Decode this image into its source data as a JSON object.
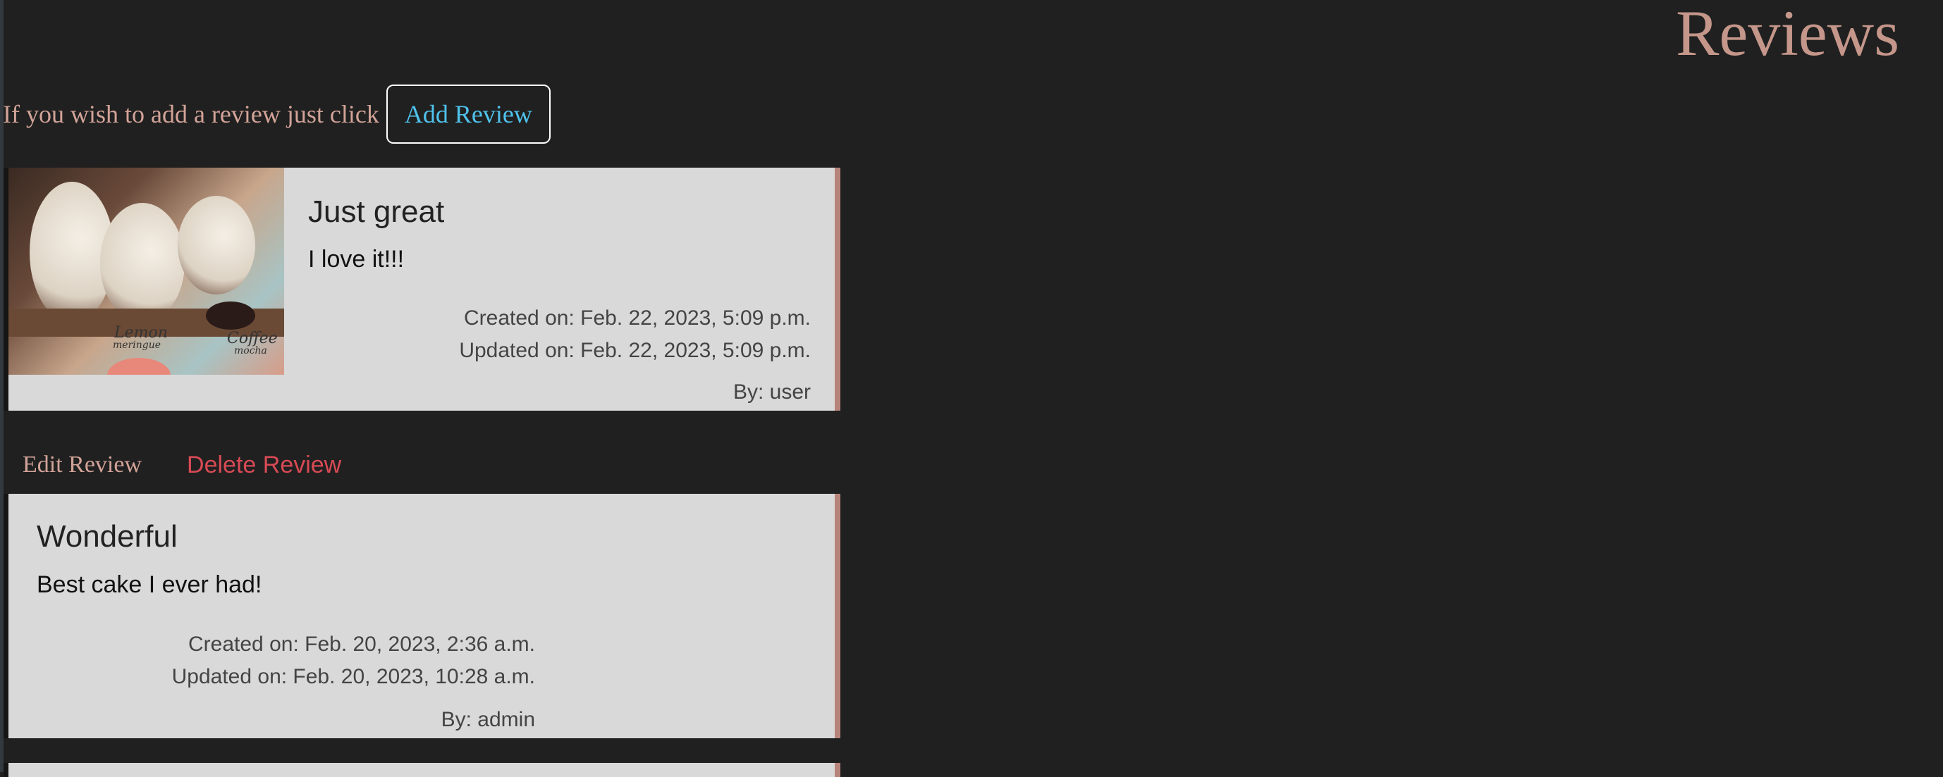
{
  "header": {
    "title": "Reviews"
  },
  "intro": {
    "text": "If you wish to add a review just click",
    "add_button_label": "Add Review"
  },
  "reviews": [
    {
      "title": "Just great",
      "body": "I love it!!!",
      "created": "Created on: Feb. 22, 2023, 5:09 p.m.",
      "updated": "Updated on: Feb. 22, 2023, 5:09 p.m.",
      "author": "By: user",
      "image": {
        "icon": "macaron-photo",
        "labels": [
          "Lemon",
          "meringue",
          "Coffee",
          "mocha"
        ]
      }
    },
    {
      "title": "Wonderful",
      "body": "Best cake I ever had!",
      "created": "Created on: Feb. 20, 2023, 2:36 a.m.",
      "updated": "Updated on: Feb. 20, 2023, 10:28 a.m.",
      "author": "By: admin"
    }
  ],
  "actions": {
    "edit_label": "Edit Review",
    "delete_label": "Delete Review"
  },
  "colors": {
    "background": "#202020",
    "title": "#c5968a",
    "link": "#4fc2ec",
    "delete": "#d84a55",
    "card": "#d9d9d9"
  }
}
